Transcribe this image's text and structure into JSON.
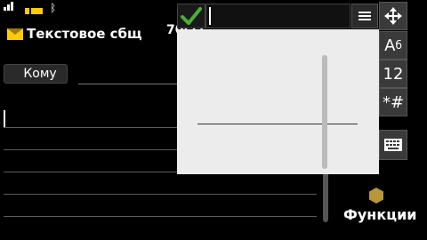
{
  "title": {
    "text": "Текстовое сбщ"
  },
  "counter": {
    "text": "70(1)"
  },
  "recipient": {
    "label": "Кому"
  },
  "input_bar": {
    "ok": "check-icon",
    "menu": "menu-icon"
  },
  "modes": [
    {
      "main": "A",
      "sub": "б"
    },
    {
      "main": "12"
    },
    {
      "main": "*#"
    }
  ],
  "functions": {
    "label": "Функции"
  },
  "colors": {
    "accent": "#ffcc00",
    "check": "#4caf3a",
    "panel": "#ececec",
    "hex": "#b8963a"
  }
}
